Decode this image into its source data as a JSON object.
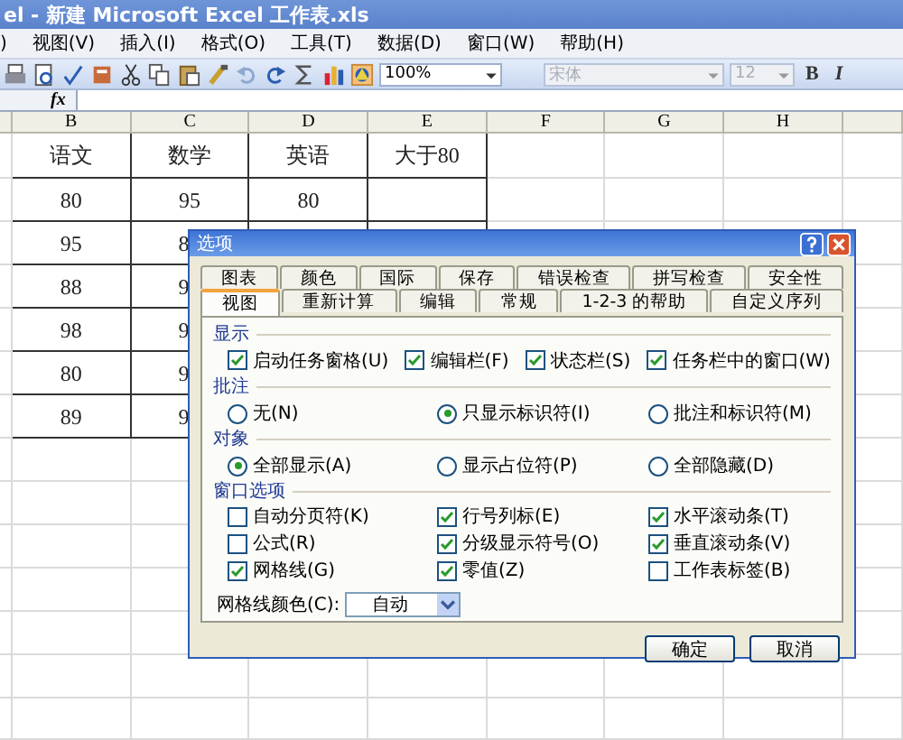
{
  "window": {
    "title": "el - 新建 Microsoft Excel 工作表.xls"
  },
  "menu": [
    ")",
    "视图(V)",
    "插入(I)",
    "格式(O)",
    "工具(T)",
    "数据(D)",
    "窗口(W)",
    "帮助(H)"
  ],
  "toolbar": {
    "zoom": "100%",
    "font": "宋体",
    "font_size": "12",
    "format_buttons": [
      "B",
      "I"
    ]
  },
  "formula_bar": {
    "fx": "fx"
  },
  "sheet": {
    "columns": [
      "B",
      "C",
      "D",
      "E",
      "F",
      "G",
      "H"
    ],
    "rows": [
      [
        {
          "text": "语文"
        },
        {
          "text": "数学"
        },
        {
          "text": "英语"
        },
        {
          "text": "大于80"
        }
      ],
      [
        {
          "text": "80"
        },
        {
          "text": "95"
        },
        {
          "text": "80"
        },
        {
          "text": ""
        }
      ],
      [
        {
          "text": "95"
        },
        {
          "text": "8",
          "clipped": true
        }
      ],
      [
        {
          "text": "88"
        },
        {
          "text": "9",
          "clipped": true
        }
      ],
      [
        {
          "text": "98"
        },
        {
          "text": "9",
          "clipped": true
        }
      ],
      [
        {
          "text": "80"
        },
        {
          "text": "9",
          "clipped": true
        }
      ],
      [
        {
          "text": "89"
        },
        {
          "text": "9",
          "clipped": true
        }
      ]
    ]
  },
  "dialog": {
    "title": "选项",
    "tabs_back": [
      {
        "label": "图表",
        "selected": false
      },
      {
        "label": "颜色",
        "selected": false
      },
      {
        "label": "国际",
        "selected": false
      },
      {
        "label": "保存",
        "selected": false
      },
      {
        "label": "错误检查",
        "selected": false
      },
      {
        "label": "拼写检查",
        "selected": false
      },
      {
        "label": "安全性",
        "selected": false
      }
    ],
    "tabs_front": [
      {
        "label": "视图",
        "selected": true
      },
      {
        "label": "重新计算",
        "selected": false
      },
      {
        "label": "编辑",
        "selected": false
      },
      {
        "label": "常规",
        "selected": false
      },
      {
        "label": "1-2-3 的帮助",
        "selected": false
      },
      {
        "label": "自定义序列",
        "selected": false
      }
    ],
    "sections": [
      {
        "heading": "显示",
        "kind": "checks",
        "items": [
          {
            "label": "启动任务窗格(U)",
            "checked": true
          },
          {
            "label": "编辑栏(F)",
            "checked": true
          },
          {
            "label": "状态栏(S)",
            "checked": true
          },
          {
            "label": "任务栏中的窗口(W)",
            "checked": true
          }
        ]
      },
      {
        "heading": "批注",
        "kind": "radios",
        "items": [
          {
            "label": "无(N)",
            "selected": false
          },
          {
            "label": "只显示标识符(I)",
            "selected": true
          },
          {
            "label": "批注和标识符(M)",
            "selected": false
          }
        ]
      },
      {
        "heading": "对象",
        "kind": "radios",
        "items": [
          {
            "label": "全部显示(A)",
            "selected": true
          },
          {
            "label": "显示占位符(P)",
            "selected": false
          },
          {
            "label": "全部隐藏(D)",
            "selected": false
          }
        ]
      },
      {
        "heading": "窗口选项",
        "kind": "grid",
        "items": [
          {
            "label": "自动分页符(K)",
            "checked": false
          },
          {
            "label": "行号列标(E)",
            "checked": true
          },
          {
            "label": "水平滚动条(T)",
            "checked": true
          },
          {
            "label": "公式(R)",
            "checked": false
          },
          {
            "label": "分级显示符号(O)",
            "checked": true
          },
          {
            "label": "垂直滚动条(V)",
            "checked": true
          },
          {
            "label": "网格线(G)",
            "checked": true
          },
          {
            "label": "零值(Z)",
            "checked": true
          },
          {
            "label": "工作表标签(B)",
            "checked": false
          }
        ]
      }
    ],
    "gridline_color": {
      "label": "网格线颜色(C):",
      "value": "自动"
    },
    "buttons": [
      "确定",
      "取消"
    ]
  }
}
